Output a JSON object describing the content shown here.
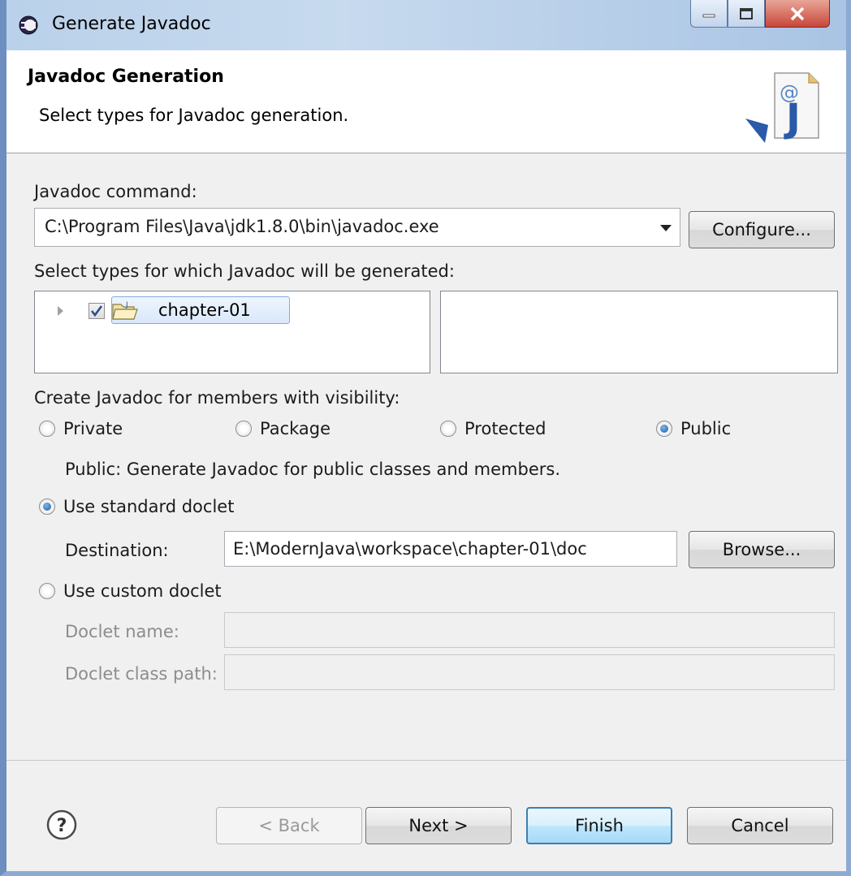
{
  "window": {
    "title": "Generate Javadoc"
  },
  "banner": {
    "title": "Javadoc Generation",
    "description": "Select types for Javadoc generation.",
    "icon": "javadoc-wizard-icon"
  },
  "javadoc_command": {
    "label": "Javadoc command:",
    "value": "C:\\Program Files\\Java\\jdk1.8.0\\bin\\javadoc.exe",
    "configure_label": "Configure..."
  },
  "types": {
    "label": "Select types for which Javadoc will be generated:",
    "tree": [
      {
        "label": "chapter-01",
        "checked": true,
        "expanded": false,
        "icon": "project-folder-icon"
      }
    ]
  },
  "visibility": {
    "label": "Create Javadoc for members with visibility:",
    "options": [
      "Private",
      "Package",
      "Protected",
      "Public"
    ],
    "selected": "Public",
    "description": "Public: Generate Javadoc for public classes and members."
  },
  "standard_doclet": {
    "label": "Use standard doclet",
    "selected": true,
    "destination_label": "Destination:",
    "destination_value": "E:\\ModernJava\\workspace\\chapter-01\\doc",
    "browse_label": "Browse..."
  },
  "custom_doclet": {
    "label": "Use custom doclet",
    "selected": false,
    "doclet_name_label": "Doclet name:",
    "doclet_name_value": "",
    "doclet_class_path_label": "Doclet class path:",
    "doclet_class_path_value": ""
  },
  "footer": {
    "back_label": "< Back",
    "next_label": "Next >",
    "finish_label": "Finish",
    "cancel_label": "Cancel"
  },
  "colors": {
    "accent": "#3c7fb1",
    "titlebar": "#b9d1ea",
    "close_button": "#c8473a"
  }
}
